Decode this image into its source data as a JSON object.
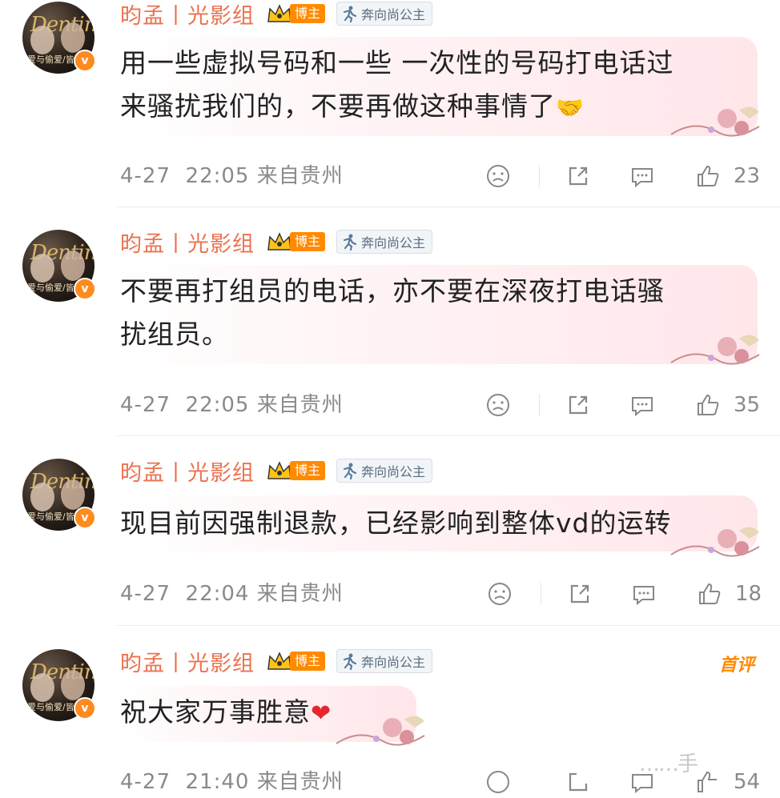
{
  "comments": [
    {
      "username": "昀孟丨光影组",
      "vip_badge": "博主",
      "fan_badge": "奔向尚公主",
      "avatar_caption": "爱与偷爱/皆",
      "text_line1": "用一些虚拟号码和一些 一次性的号码打电话过",
      "text_line2": "来骚扰我们的，不要再做这种事情了",
      "emoji": "🤝",
      "date": "4-27",
      "time": "22:05",
      "location": "来自贵州",
      "likes": "23"
    },
    {
      "username": "昀孟丨光影组",
      "vip_badge": "博主",
      "fan_badge": "奔向尚公主",
      "avatar_caption": "爱与偷爱/皆",
      "text_line1": "不要再打组员的电话，亦不要在深夜打电话骚",
      "text_line2": "扰组员。",
      "date": "4-27",
      "time": "22:05",
      "location": "来自贵州",
      "likes": "35"
    },
    {
      "username": "昀孟丨光影组",
      "vip_badge": "博主",
      "fan_badge": "奔向尚公主",
      "avatar_caption": "爱与偷爱/皆",
      "text_line1": "现目前因强制退款，已经影响到整体vd的运转",
      "date": "4-27",
      "time": "22:04",
      "location": "来自贵州",
      "likes": "18"
    },
    {
      "username": "昀孟丨光影组",
      "vip_badge": "博主",
      "fan_badge": "奔向尚公主",
      "avatar_caption": "爱与偷爱/皆",
      "first_comment_tag": "首评",
      "text_line1": "祝大家万事胜意",
      "emoji": "❤",
      "date": "4-27",
      "time": "21:40",
      "location": "来自贵州",
      "likes": "54"
    }
  ],
  "watermark": "……手",
  "colors": {
    "username": "#eb7350",
    "vip_badge": "#ff8a00",
    "verify": "#ff8a1f",
    "meta_text": "#8a8a8a",
    "bubble_tint": "#ffe6ea"
  },
  "icons": {
    "verify": "v-verified-icon",
    "crown": "crown-icon",
    "fan": "running-figure-icon",
    "dislike": "sad-face-icon",
    "repost": "share-icon",
    "comment": "comment-bubble-icon",
    "like": "thumbs-up-icon"
  }
}
